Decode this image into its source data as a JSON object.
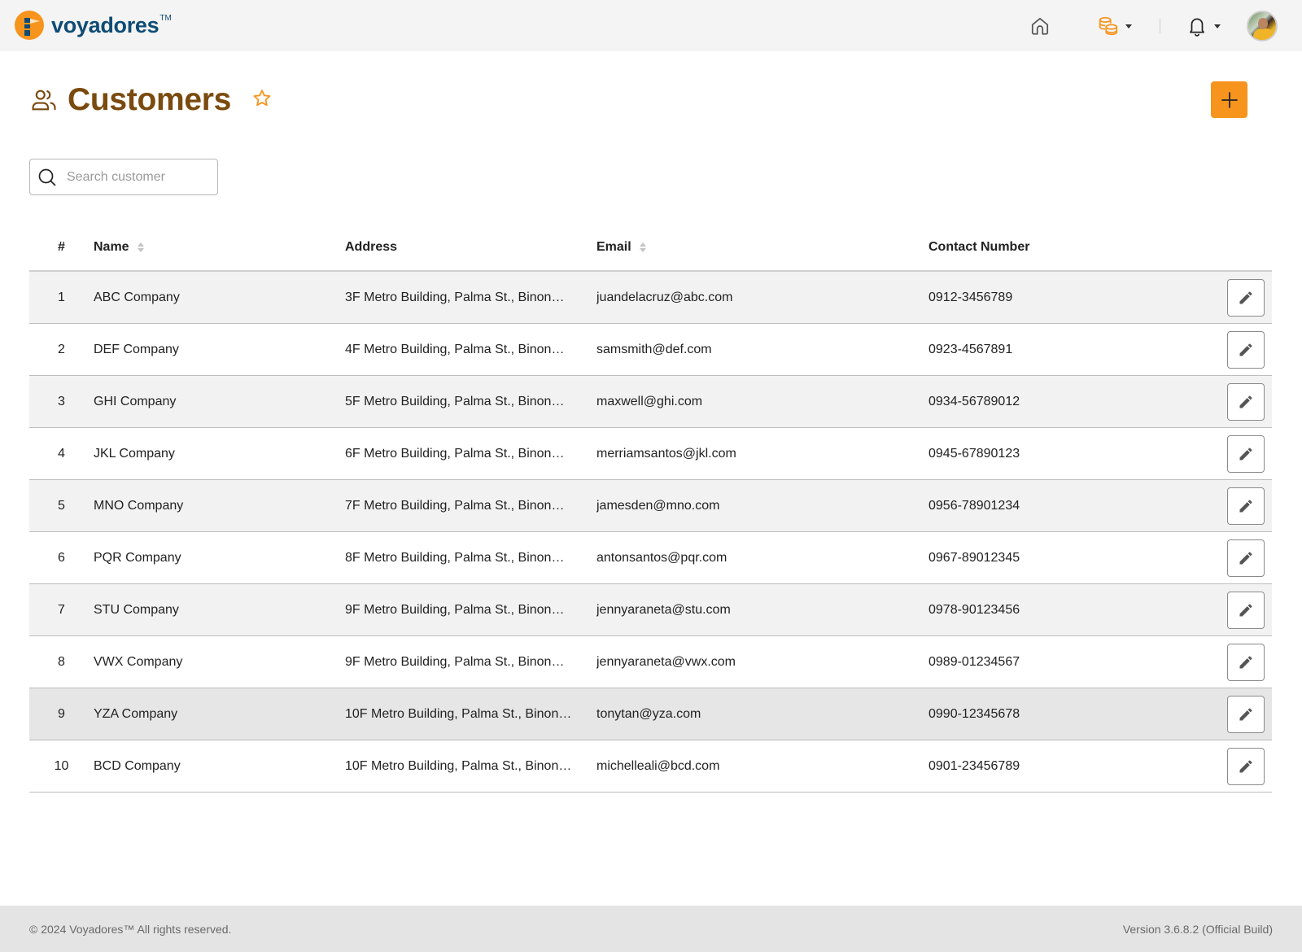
{
  "app": {
    "brand_name": "voyadores",
    "brand_tm": "TM",
    "accent_color": "#f7941d",
    "title_color": "#7a4a0e",
    "brand_color": "#0f4c75"
  },
  "nav": {
    "icons": [
      "home-icon",
      "coins-icon",
      "bell-icon",
      "user-avatar"
    ]
  },
  "page": {
    "title": "Customers",
    "title_icon": "users-icon",
    "favorite_icon": "star-icon",
    "add_button_icon": "plus-icon"
  },
  "search": {
    "placeholder": "Search customer",
    "value": ""
  },
  "table": {
    "columns": [
      {
        "label": "#",
        "sortable": false
      },
      {
        "label": "Name",
        "sortable": true
      },
      {
        "label": "Address",
        "sortable": false
      },
      {
        "label": "Email",
        "sortable": true
      },
      {
        "label": "Contact Number",
        "sortable": false
      }
    ],
    "rows": [
      {
        "num": "1",
        "name": "ABC Company",
        "address": "3F Metro Building, Palma St., Binon…",
        "email": "juandelacruz@abc.com",
        "contact": "0912-3456789"
      },
      {
        "num": "2",
        "name": "DEF Company",
        "address": "4F Metro Building, Palma St., Binon…",
        "email": "samsmith@def.com",
        "contact": "0923-4567891"
      },
      {
        "num": "3",
        "name": "GHI Company",
        "address": "5F Metro Building, Palma St., Binon…",
        "email": "maxwell@ghi.com",
        "contact": "0934-56789012"
      },
      {
        "num": "4",
        "name": "JKL Company",
        "address": "6F Metro Building, Palma St., Binon…",
        "email": "merriamsantos@jkl.com",
        "contact": "0945-67890123"
      },
      {
        "num": "5",
        "name": "MNO Company",
        "address": "7F Metro Building, Palma St., Binon…",
        "email": "jamesden@mno.com",
        "contact": "0956-78901234"
      },
      {
        "num": "6",
        "name": "PQR Company",
        "address": "8F Metro Building, Palma St., Binon…",
        "email": "antonsantos@pqr.com",
        "contact": "0967-89012345"
      },
      {
        "num": "7",
        "name": "STU Company",
        "address": "9F Metro Building, Palma St., Binon…",
        "email": "jennyaraneta@stu.com",
        "contact": "0978-90123456"
      },
      {
        "num": "8",
        "name": "VWX Company",
        "address": "9F Metro Building, Palma St., Binon…",
        "email": "jennyaraneta@vwx.com",
        "contact": "0989-01234567"
      },
      {
        "num": "9",
        "name": "YZA Company",
        "address": "10F Metro Building, Palma St., Binon…",
        "email": "tonytan@yza.com",
        "contact": "0990-12345678"
      },
      {
        "num": "10",
        "name": "BCD Company",
        "address": "10F Metro Building, Palma St., Binon…",
        "email": "michelleali@bcd.com",
        "contact": "0901-23456789"
      }
    ],
    "row_action_icon": "pencil-icon"
  },
  "footer": {
    "copyright": "© 2024 Voyadores™ All rights reserved.",
    "version": "Version 3.6.8.2 (Official Build)"
  }
}
